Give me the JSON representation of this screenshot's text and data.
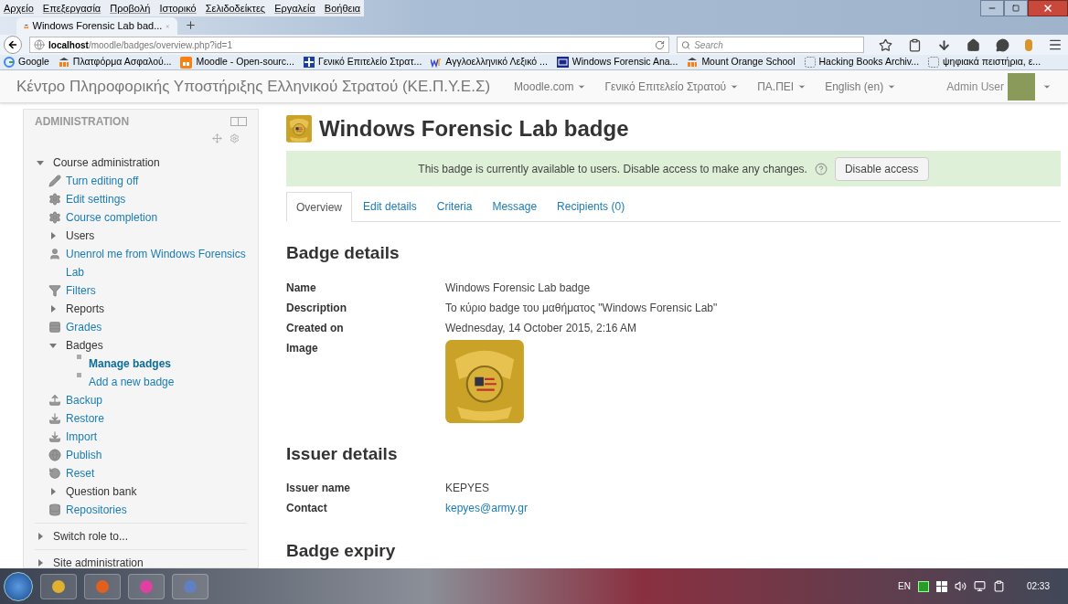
{
  "browser": {
    "menu": [
      "Αρχείο",
      "Επεξεργασία",
      "Προβολή",
      "Ιστορικό",
      "Σελιδοδείκτες",
      "Εργαλεία",
      "Βοήθεια"
    ],
    "tab": {
      "title": "Windows Forensic Lab bad...",
      "selected": true
    },
    "url": {
      "host": "localhost",
      "path": "/moodle/badges/overview.php?id=1"
    },
    "search": {
      "placeholder": "Search"
    },
    "bookmarks": [
      {
        "label": "Google",
        "kind": "google"
      },
      {
        "label": "Πλατφόρμα Ασφαλού...",
        "kind": "moodle"
      },
      {
        "label": "Moodle - Open-sourc...",
        "kind": "moodle-box"
      },
      {
        "label": "Γενικό Επιτελείο Στρατ...",
        "kind": "flag"
      },
      {
        "label": "Αγγλοελληνικό Λεξικό ...",
        "kind": "wr"
      },
      {
        "label": "Windows Forensic Ana...",
        "kind": "sans"
      },
      {
        "label": "Mount Orange School",
        "kind": "moodle"
      },
      {
        "label": "Hacking Books Archiv...",
        "kind": "blank"
      },
      {
        "label": "ψηφιακά πειστήρια, ε...",
        "kind": "blank"
      }
    ]
  },
  "site": {
    "title": "Κέντρο Πληροφορικής Υποστήριξης Ελληνικού Στρατού (ΚΕ.Π.Υ.Ε.Σ)",
    "menus": [
      "Moodle.com",
      "Γενικό Επιτελείο Στρατού",
      "ΠΑ.ΠΕΙ",
      "English (en)"
    ],
    "user": "Admin User"
  },
  "sidebar": {
    "title": "ADMINISTRATION",
    "items": [
      {
        "label": "Course administration",
        "kind": "branch",
        "expanded": true,
        "children": [
          {
            "label": "Turn editing off",
            "kind": "link"
          },
          {
            "label": "Edit settings",
            "kind": "link"
          },
          {
            "label": "Course completion",
            "kind": "link"
          },
          {
            "label": "Users",
            "kind": "branch",
            "expanded": false
          },
          {
            "label": "Unenrol me from Windows Forensics Lab",
            "kind": "link"
          },
          {
            "label": "Filters",
            "kind": "link"
          },
          {
            "label": "Reports",
            "kind": "branch",
            "expanded": false
          },
          {
            "label": "Grades",
            "kind": "link"
          },
          {
            "label": "Badges",
            "kind": "branch",
            "expanded": true,
            "children": [
              {
                "label": "Manage badges",
                "kind": "leaf",
                "selected": true
              },
              {
                "label": "Add a new badge",
                "kind": "leaf",
                "selected": false
              }
            ]
          },
          {
            "label": "Backup",
            "kind": "link"
          },
          {
            "label": "Restore",
            "kind": "link"
          },
          {
            "label": "Import",
            "kind": "link"
          },
          {
            "label": "Publish",
            "kind": "link"
          },
          {
            "label": "Reset",
            "kind": "link"
          },
          {
            "label": "Question bank",
            "kind": "branch",
            "expanded": false
          },
          {
            "label": "Repositories",
            "kind": "link"
          }
        ]
      },
      {
        "label": "Switch role to...",
        "kind": "branch",
        "expanded": false
      },
      {
        "label": "Site administration",
        "kind": "branch",
        "expanded": false
      }
    ]
  },
  "page": {
    "title": "Windows Forensic Lab badge",
    "alert": {
      "text": "This badge is currently available to users. Disable access to make any changes.",
      "button": "Disable access"
    },
    "tabs": [
      {
        "label": "Overview",
        "selected": true
      },
      {
        "label": "Edit details",
        "selected": false
      },
      {
        "label": "Criteria",
        "selected": false
      },
      {
        "label": "Message",
        "selected": false
      },
      {
        "label": "Recipients (0)",
        "selected": false
      }
    ],
    "sections": [
      {
        "heading": "Badge details",
        "rows": [
          {
            "label": "Name",
            "value": "Windows Forensic Lab badge",
            "kind": "text"
          },
          {
            "label": "Description",
            "value": "Το κύριο badge του μαθήματος \"Windows Forensic Lab\"",
            "kind": "text"
          },
          {
            "label": "Created on",
            "value": "Wednesday, 14 October 2015, 2:16 AM",
            "kind": "text"
          },
          {
            "label": "Image",
            "kind": "image"
          }
        ]
      },
      {
        "heading": "Issuer details",
        "rows": [
          {
            "label": "Issuer name",
            "value": "KEPYES",
            "kind": "text"
          },
          {
            "label": "Contact",
            "value": "kepyes@army.gr",
            "kind": "link"
          }
        ]
      },
      {
        "heading": "Badge expiry"
      }
    ]
  },
  "taskbar": {
    "language": "EN",
    "time": "02:33"
  }
}
